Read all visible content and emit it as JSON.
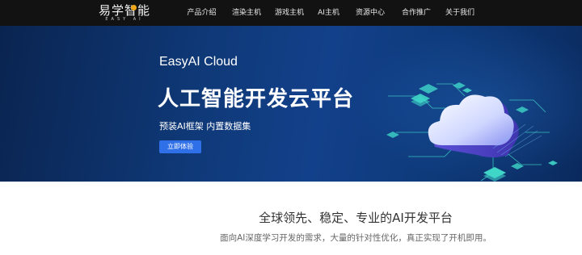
{
  "logo": {
    "text": "易学智能",
    "sub": "EASY AI"
  },
  "nav": [
    "产品介绍",
    "渲染主机",
    "游戏主机",
    "AI主机",
    "资源中心",
    "合作推广",
    "关于我们"
  ],
  "hero": {
    "subtitle": "EasyAI Cloud",
    "title": "人工智能开发云平台",
    "description": "预装AI框架 内置数据集",
    "button": "立即体验",
    "slide_count": 5,
    "active_slide": 5
  },
  "section": {
    "title": "全球领先、稳定、专业的AI开发平台",
    "description": "面向AI深度学习开发的需求，大量的针对性优化，真正实现了开机即用。"
  },
  "colors": {
    "topbar": "#121212",
    "hero": "#0f3978",
    "button": "#2f6fe8",
    "accent_cyan": "#3fd6c8"
  }
}
